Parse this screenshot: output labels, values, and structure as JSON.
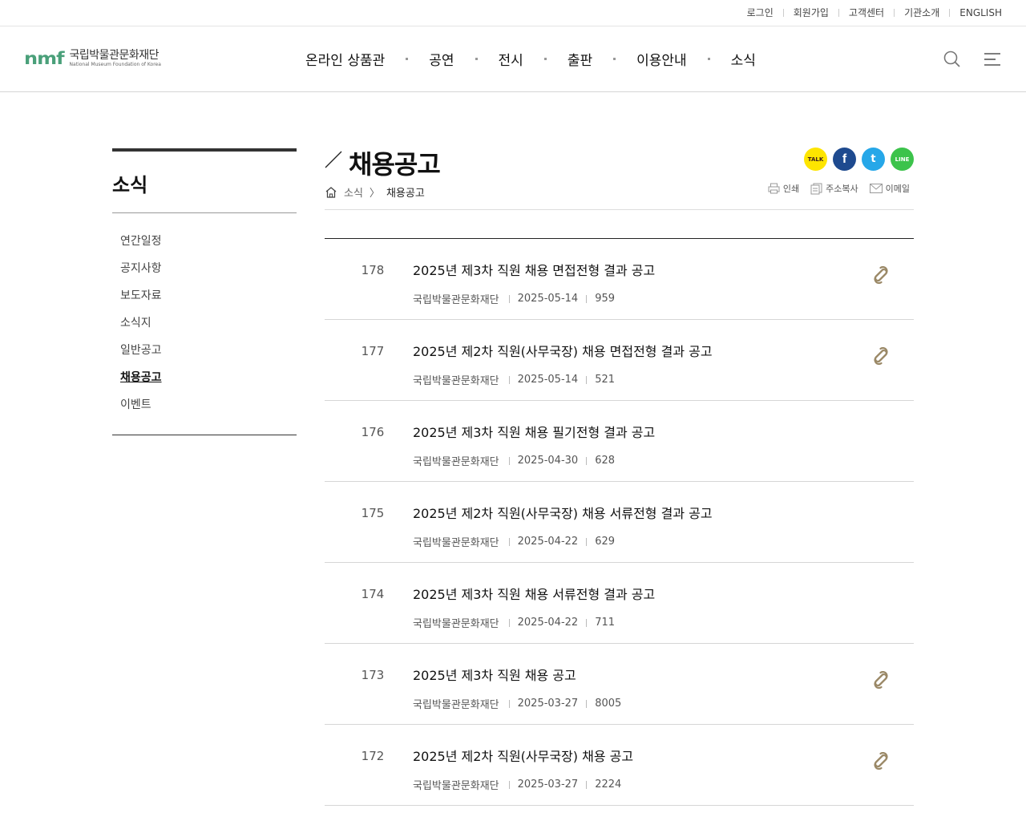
{
  "util": {
    "login": "로그인",
    "join": "회원가입",
    "support": "고객센터",
    "about": "기관소개",
    "english": "ENGLISH"
  },
  "header": {
    "logo_mark": "nmf",
    "logo_ko": "국립박물관문화재단",
    "logo_en": "National Museum Foundation of Korea",
    "nav": [
      "온라인 상품관",
      "공연",
      "전시",
      "출판",
      "이용안내",
      "소식"
    ]
  },
  "sidebar": {
    "title": "소식",
    "items": [
      "연간일정",
      "공지사항",
      "보도자료",
      "소식지",
      "일반공고",
      "채용공고",
      "이벤트"
    ],
    "active": "채용공고"
  },
  "page": {
    "title": "채용공고",
    "breadcrumb": {
      "parent": "소식",
      "sep": "〉",
      "current": "채용공고"
    },
    "share": {
      "kakao": "TALK",
      "facebook": "f",
      "twitter": "t",
      "line": "LINE"
    },
    "tools": {
      "print": "인쇄",
      "copy_url": "주소복사",
      "email": "이메일"
    }
  },
  "posts": [
    {
      "num": "178",
      "title": "2025년 제3차 직원 채용 면접전형 결과 공고",
      "author": "국립박물관문화재단",
      "date": "2025-05-14",
      "views": "959",
      "attachment": true
    },
    {
      "num": "177",
      "title": "2025년 제2차 직원(사무국장) 채용 면접전형 결과 공고",
      "author": "국립박물관문화재단",
      "date": "2025-05-14",
      "views": "521",
      "attachment": true
    },
    {
      "num": "176",
      "title": "2025년 제3차 직원 채용 필기전형 결과 공고",
      "author": "국립박물관문화재단",
      "date": "2025-04-30",
      "views": "628",
      "attachment": false
    },
    {
      "num": "175",
      "title": "2025년 제2차 직원(사무국장) 채용 서류전형 결과 공고",
      "author": "국립박물관문화재단",
      "date": "2025-04-22",
      "views": "629",
      "attachment": false
    },
    {
      "num": "174",
      "title": "2025년 제3차 직원 채용 서류전형 결과 공고",
      "author": "국립박물관문화재단",
      "date": "2025-04-22",
      "views": "711",
      "attachment": false
    },
    {
      "num": "173",
      "title": "2025년 제3차 직원 채용 공고",
      "author": "국립박물관문화재단",
      "date": "2025-03-27",
      "views": "8005",
      "attachment": true
    },
    {
      "num": "172",
      "title": "2025년 제2차 직원(사무국장) 채용 공고",
      "author": "국립박물관문화재단",
      "date": "2025-03-27",
      "views": "2224",
      "attachment": true
    }
  ],
  "colors": {
    "brand": "#4aa07a",
    "attachment": "#9a8866"
  },
  "icons": {
    "search": "search-icon",
    "menu": "hamburger-icon",
    "home": "home-icon",
    "attachment": "paperclip-icon"
  }
}
